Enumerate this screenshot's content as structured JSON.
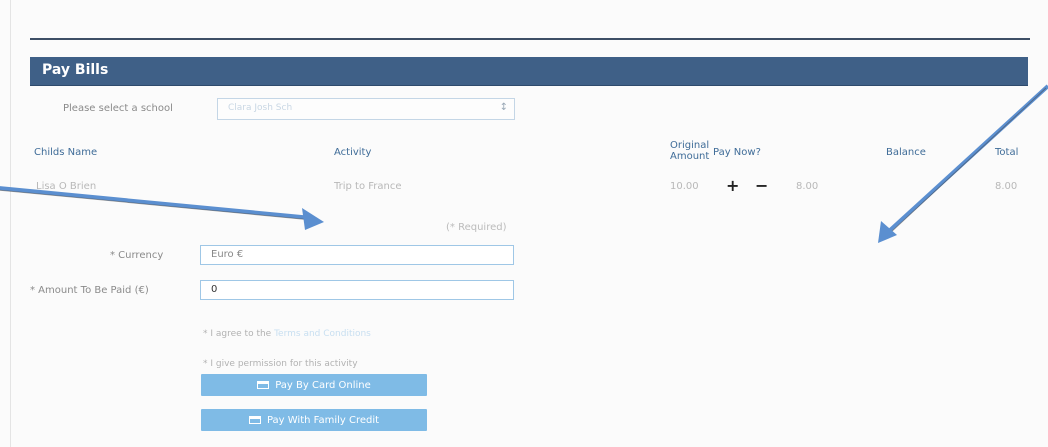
{
  "panel": {
    "title": "Pay Bills"
  },
  "school": {
    "label": "Please select a school",
    "selected": "Clara Josh Sch"
  },
  "table": {
    "headers": {
      "child": "Childs Name",
      "activity": "Activity",
      "original_amount_line1": "Original",
      "original_amount_line2": "Amount",
      "pay_now": "Pay Now?",
      "balance": "Balance",
      "total": "Total"
    },
    "rows": [
      {
        "child": "Lisa O Brien",
        "activity": "Trip to France",
        "original_amount": "10.00",
        "pay_now_amount": "8.00",
        "balance": "",
        "total": "8.00"
      }
    ]
  },
  "form": {
    "required_note": "(* Required)",
    "currency_label": "* Currency",
    "currency_value": "Euro €",
    "amount_label": "* Amount To Be Paid (€)",
    "amount_value": "0",
    "terms_prefix": "* I agree to the ",
    "terms_link": "Terms and Conditions",
    "permission_text": "* I give permission for this activity",
    "pay_card_button": "Pay By Card Online",
    "pay_credit_button": "Pay With Family Credit"
  },
  "colors": {
    "header_bar": "#3f6087",
    "button": "#7fbbe6",
    "arrow": "#5b8fd0"
  }
}
